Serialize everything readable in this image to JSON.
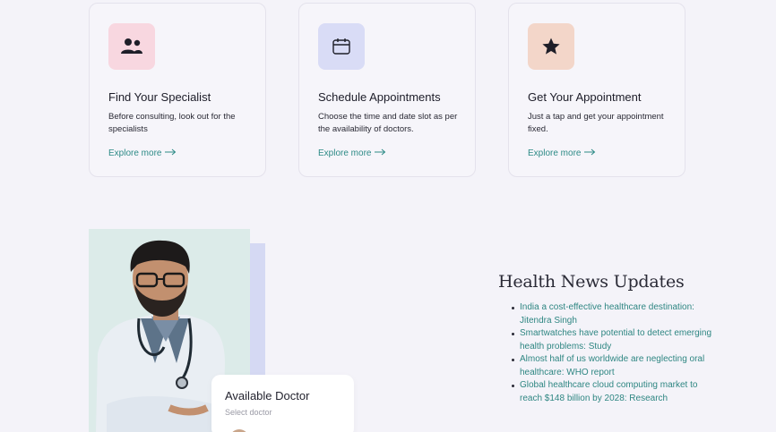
{
  "cards": [
    {
      "title": "Find Your Specialist",
      "desc": "Before consulting, look out for the specialists",
      "link": "Explore more",
      "icon": "users-icon",
      "icon_bg": "#f8d7e0"
    },
    {
      "title": "Schedule Appointments",
      "desc": "Choose the time and date slot as per the availability of doctors.",
      "link": "Explore more",
      "icon": "calendar-icon",
      "icon_bg": "#d9dcf6"
    },
    {
      "title": "Get Your Appointment",
      "desc": "Just a tap and get your appointment fixed.",
      "link": "Explore more",
      "icon": "star-icon",
      "icon_bg": "#f3d6c9"
    }
  ],
  "available_doctor": {
    "title": "Available Doctor",
    "subtitle": "Select doctor"
  },
  "news": {
    "title": "Health News Updates",
    "items": [
      "India a cost-effective healthcare destination: Jitendra Singh",
      "Smartwatches have potential to detect emerging health problems: Study",
      "Almost half of us worldwide are neglecting oral healthcare: WHO report",
      "Global healthcare cloud computing market to reach $148 billion by 2028: Research"
    ]
  },
  "colors": {
    "accent": "#2d8a86",
    "background": "#f4f3f9"
  }
}
